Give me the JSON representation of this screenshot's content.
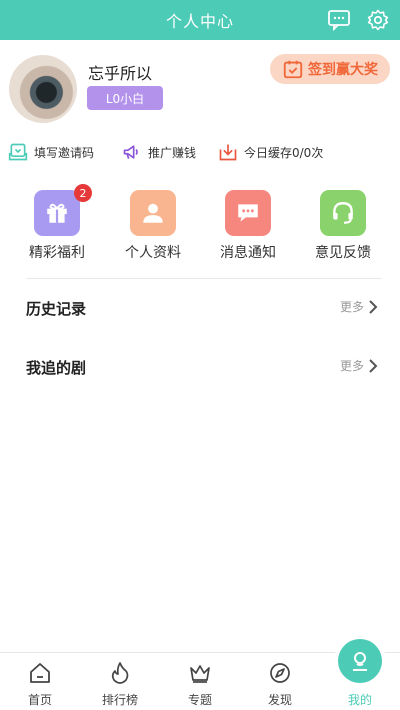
{
  "header": {
    "title": "个人中心",
    "message_icon": "chat-bubble-icon",
    "settings_icon": "gear-icon"
  },
  "profile": {
    "username": "忘乎所以",
    "level": "L0小白",
    "signin_label": "签到赢大奖",
    "signin_icon": "calendar-check-icon"
  },
  "quick_actions": [
    {
      "label": "填写邀请码",
      "icon": "invite-code-icon"
    },
    {
      "label": "推广赚钱",
      "icon": "megaphone-icon"
    },
    {
      "label": "今日缓存0/0次",
      "icon": "download-icon"
    }
  ],
  "features": [
    {
      "label": "精彩福利",
      "icon": "gift-icon",
      "badge": "2"
    },
    {
      "label": "个人资料",
      "icon": "user-icon"
    },
    {
      "label": "消息通知",
      "icon": "message-icon"
    },
    {
      "label": "意见反馈",
      "icon": "headset-icon"
    }
  ],
  "sections": [
    {
      "title": "历史记录",
      "more": "更多"
    },
    {
      "title": "我追的剧",
      "more": "更多"
    }
  ],
  "tabbar": [
    {
      "label": "首页",
      "icon": "home-icon"
    },
    {
      "label": "排行榜",
      "icon": "flame-icon"
    },
    {
      "label": "专题",
      "icon": "crown-icon"
    },
    {
      "label": "发现",
      "icon": "compass-icon"
    },
    {
      "label": "我的",
      "icon": "profile-icon",
      "active": true
    }
  ],
  "colors": {
    "accent": "#4ccbb6",
    "level_badge": "#b392ec",
    "signin_bg": "#fbd6c5",
    "signin_text": "#f0683a",
    "gift_bg": "#a99af1",
    "profile_bg": "#f9b58f",
    "message_bg": "#f6877e",
    "feedback_bg": "#8ad26b",
    "badge": "#e63a3a"
  }
}
